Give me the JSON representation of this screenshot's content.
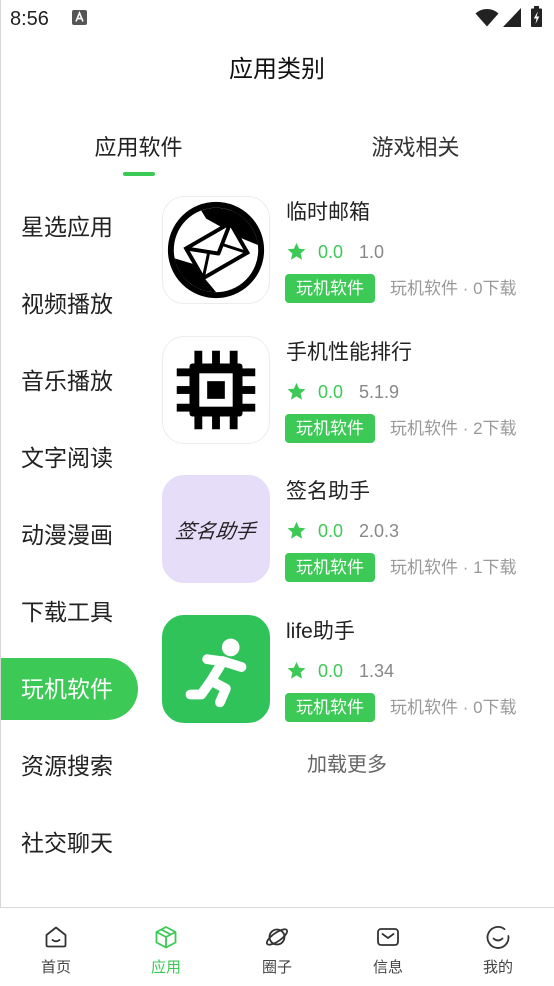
{
  "status_bar": {
    "time": "8:56",
    "icons": [
      "a-notification-icon",
      "wifi-icon",
      "signal-icon",
      "battery-charging-icon"
    ]
  },
  "header": {
    "title": "应用类别"
  },
  "tabs": [
    {
      "label": "应用软件",
      "selected": true
    },
    {
      "label": "游戏相关",
      "selected": false
    }
  ],
  "sidebar": {
    "selected_index": 6,
    "items": [
      {
        "label": "星选应用"
      },
      {
        "label": "视频播放"
      },
      {
        "label": "音乐播放"
      },
      {
        "label": "文字阅读"
      },
      {
        "label": "动漫漫画"
      },
      {
        "label": "下载工具"
      },
      {
        "label": "玩机软件"
      },
      {
        "label": "资源搜索"
      },
      {
        "label": "社交聊天"
      }
    ]
  },
  "rating_icon": "star-icon",
  "apps": [
    {
      "name": "临时邮箱",
      "icon": "envelope-circle-icon",
      "rating": "0.0",
      "version": "1.0",
      "tag": "玩机软件",
      "meta": "玩机软件 · 0下载"
    },
    {
      "name": "手机性能排行",
      "icon": "chip-icon",
      "rating": "0.0",
      "version": "5.1.9",
      "tag": "玩机软件",
      "meta": "玩机软件 · 2下载"
    },
    {
      "name": "签名助手",
      "icon": "signature-text-icon",
      "icon_text": "签名助手",
      "rating": "0.0",
      "version": "2.0.3",
      "tag": "玩机软件",
      "meta": "玩机软件 · 1下载"
    },
    {
      "name": "life助手",
      "icon": "running-person-icon",
      "rating": "0.0",
      "version": "1.34",
      "tag": "玩机软件",
      "meta": "玩机软件 · 0下载"
    }
  ],
  "load_more": "加载更多",
  "bottom_nav": {
    "selected_index": 1,
    "items": [
      {
        "label": "首页",
        "icon": "home-icon"
      },
      {
        "label": "应用",
        "icon": "cube-icon"
      },
      {
        "label": "圈子",
        "icon": "planet-icon"
      },
      {
        "label": "信息",
        "icon": "mail-icon"
      },
      {
        "label": "我的",
        "icon": "smiley-icon"
      }
    ]
  },
  "colors": {
    "accent": "#3cc955",
    "text": "#222222",
    "muted": "#999999",
    "signature_icon_bg": "#e6ddf8",
    "life_icon_bg": "#30c35a"
  }
}
